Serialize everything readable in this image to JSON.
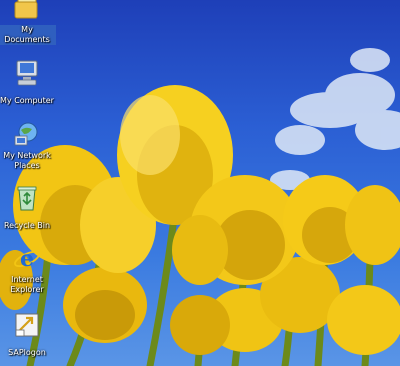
{
  "desktop": {
    "icons": [
      {
        "label": "My Documents",
        "icon": "my-documents-icon"
      },
      {
        "label": "My Computer",
        "icon": "my-computer-icon"
      },
      {
        "label": "My Network Places",
        "icon": "my-network-places-icon"
      },
      {
        "label": "Recycle Bin",
        "icon": "recycle-bin-icon"
      },
      {
        "label": "Internet Explorer",
        "icon": "internet-explorer-icon"
      },
      {
        "label": "SAPlogon",
        "icon": "saplogon-icon"
      }
    ],
    "colors": {
      "sky": "#2b5fd4",
      "tulip": "#f2c514",
      "stem": "#6c8a1a",
      "cloud": "#dfe9f7"
    }
  }
}
